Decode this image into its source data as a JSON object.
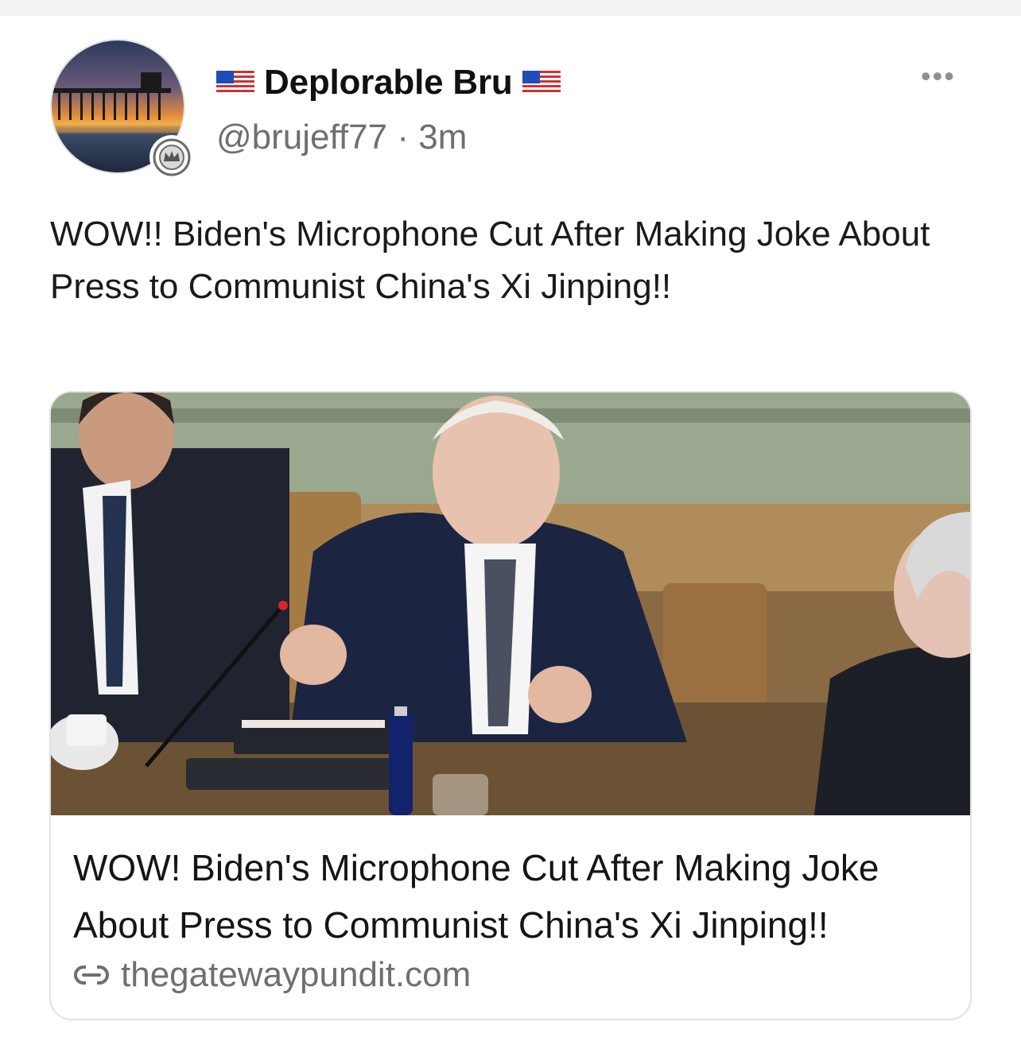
{
  "post": {
    "author": {
      "display_name": "Deplorable Bru",
      "name_prefix_icon": "us-flag-icon",
      "name_suffix_icon": "us-flag-icon",
      "handle": "@brujeff77",
      "separator": "·",
      "time": "3m",
      "avatar": "pier-sunset-avatar",
      "badge_icon": "crown-badge-icon"
    },
    "more_label": "•••",
    "text": "WOW!! Biden's Microphone Cut After Making Joke About Press to Communist China's Xi Jinping!!"
  },
  "link_card": {
    "image": "meeting-photo",
    "title": "WOW! Biden's Microphone Cut After Making Joke About Press to Communist China's Xi Jinping!!",
    "link_icon": "link-icon",
    "domain": "thegatewaypundit.com"
  },
  "colors": {
    "text_primary": "#111111",
    "text_secondary": "#6e6e73",
    "card_border": "#e2e2e5"
  }
}
